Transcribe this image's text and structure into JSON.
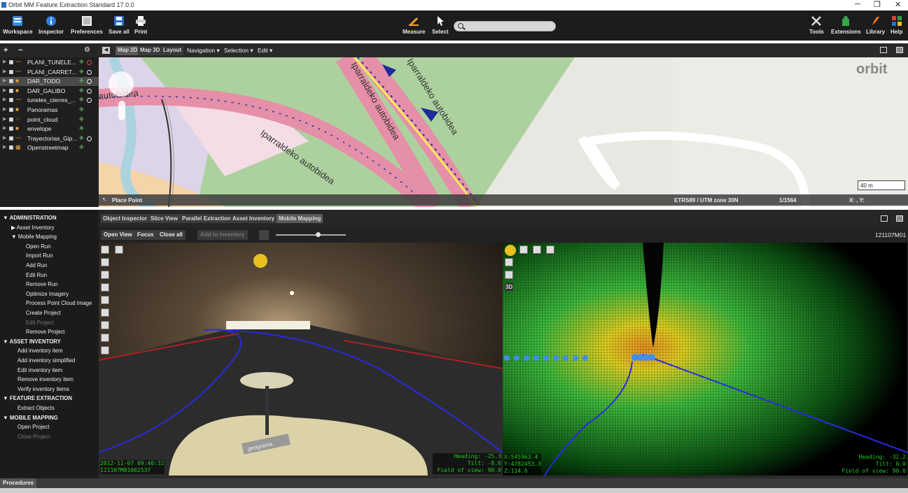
{
  "window": {
    "title": "Orbit MM Feature Extraction Standard 17.0.0",
    "minimize": "─",
    "restore": "❐",
    "close": "✕"
  },
  "ribbon": {
    "left": [
      {
        "label": "Workspace",
        "icon": "workspace-icon"
      },
      {
        "label": "Inspector",
        "icon": "info-icon"
      },
      {
        "label": "Preferences",
        "icon": "preferences-icon"
      },
      {
        "label": "Save all",
        "icon": "save-icon"
      },
      {
        "label": "Print",
        "icon": "print-icon"
      }
    ],
    "center": [
      {
        "label": "Measure",
        "icon": "measure-icon"
      },
      {
        "label": "Select",
        "icon": "cursor-icon"
      }
    ],
    "search_placeholder": "",
    "right": [
      {
        "label": "Tools",
        "icon": "tools-icon"
      },
      {
        "label": "Extensions",
        "icon": "extensions-icon"
      },
      {
        "label": "Library",
        "icon": "library-icon"
      },
      {
        "label": "Help",
        "icon": "help-icon"
      }
    ]
  },
  "layer_toolbar": {
    "add": "+",
    "remove": "−",
    "settings": "⚙"
  },
  "layers": [
    {
      "name": "PLANI_TUNELE...",
      "selected": false,
      "icon": "line-icon",
      "r2": "red"
    },
    {
      "name": "PLANI_CARRET...",
      "selected": false,
      "icon": "line-icon",
      "r2": "white"
    },
    {
      "name": "DAR_TODO",
      "selected": true,
      "icon": "point-icon",
      "r2": "white"
    },
    {
      "name": "DAR_GALIBO",
      "selected": false,
      "icon": "point-icon",
      "r2": "white"
    },
    {
      "name": "tuneles_cierres_...",
      "selected": false,
      "icon": "line-icon",
      "r2": "white"
    },
    {
      "name": "Panoramas",
      "selected": false,
      "icon": "point-icon",
      "r2": ""
    },
    {
      "name": "point_cloud",
      "selected": false,
      "icon": "cloud-icon",
      "r2": ""
    },
    {
      "name": "envelope",
      "selected": false,
      "icon": "polygon-icon",
      "r2": ""
    },
    {
      "name": "Trayectorias_Gip...",
      "selected": false,
      "icon": "line-icon",
      "r2": "white"
    },
    {
      "name": "Openstreetmap",
      "selected": false,
      "icon": "map-icon",
      "r2": ""
    }
  ],
  "map_toolbar": {
    "tabs": [
      "Map 2D",
      "Map 3D",
      "Layout"
    ],
    "active_tab": "Map 2D",
    "menus": [
      "Navigation ▾",
      "Selection ▾",
      "Edit ▾"
    ]
  },
  "map": {
    "road_labels": [
      "autobidea",
      "Iparraldeko autobidea",
      "Iparraldeko autobidea",
      "Iparraldeko autobidea"
    ],
    "logo": "orbit",
    "scale_label": "40 m",
    "status_left": "Place Point",
    "crs": "ETRS89 / UTM zone 30N",
    "scale_ratio": "1/1564",
    "coords": "X: , Y: "
  },
  "procedures": {
    "items": [
      {
        "text": "ADMINISTRATION",
        "level": 0,
        "header": true
      },
      {
        "text": "Asset Inventory",
        "level": 1,
        "header": false,
        "arrow": "▶"
      },
      {
        "text": "Mobile Mapping",
        "level": 1,
        "header": false,
        "arrow": "▼"
      },
      {
        "text": "Open Run",
        "level": 2
      },
      {
        "text": "Import Run",
        "level": 2
      },
      {
        "text": "Add Run",
        "level": 2
      },
      {
        "text": "Edit Run",
        "level": 2
      },
      {
        "text": "Remove Run",
        "level": 2
      },
      {
        "text": "Optimize Imagery",
        "level": 2
      },
      {
        "text": "Process Point Cloud Image",
        "level": 2
      },
      {
        "text": "Create Project",
        "level": 2
      },
      {
        "text": "Edit Project",
        "level": 2,
        "disabled": true
      },
      {
        "text": "Remove Project",
        "level": 2
      },
      {
        "text": "ASSET INVENTORY",
        "level": 0,
        "header": true
      },
      {
        "text": "Add inventory item",
        "level": 1
      },
      {
        "text": "Add inventory simplified",
        "level": 1
      },
      {
        "text": "Edit inventory item",
        "level": 1
      },
      {
        "text": "Remove inventory item",
        "level": 1
      },
      {
        "text": "Verify inventory items",
        "level": 1
      },
      {
        "text": "FEATURE EXTRACTION",
        "level": 0,
        "header": true
      },
      {
        "text": "Extract Objects",
        "level": 1
      },
      {
        "text": "MOBILE MAPPING",
        "level": 0,
        "header": true
      },
      {
        "text": "Open Project",
        "level": 1
      },
      {
        "text": "Close Project",
        "level": 1,
        "disabled": true
      }
    ],
    "footer": "Procedures"
  },
  "bottom_tabs": {
    "tabs": [
      "Object Inspector",
      "Slice View",
      "Parallel Extraction",
      "Asset Inventory",
      "Mobile Mapping"
    ],
    "active": "Mobile Mapping"
  },
  "view_toolbar": {
    "buttons": [
      "Open View",
      "Focus",
      "Close all"
    ],
    "disabled_button": "Add to inventory",
    "slider_value": 0.6,
    "run_id": "121107M01"
  },
  "photo_view": {
    "timestamp": "2012-11-07 09:40:32",
    "frame_id": "121107M01002537",
    "heading_label": "Heading:",
    "heading": "-25.3",
    "tilt_label": "Tilt:",
    "tilt": "-8.6",
    "fov_label": "Field of view:",
    "fov": "90.0",
    "watermark": "geograma"
  },
  "cloud_view": {
    "x_label": "X:",
    "x": "545963.4",
    "y_label": "Y:",
    "y": "4782453.3",
    "z_label": "Z:",
    "z": "114.6",
    "heading_label": "Heading:",
    "heading": "-32.2",
    "tilt_label": "Tilt:",
    "tilt": "0.0",
    "fov_label": "Field of view:",
    "fov": "90.0",
    "mode_label": "3D"
  },
  "colors": {
    "ribbon_bg": "#1c1c1c",
    "overlay_text": "#22c922",
    "motorway": "#e58fa8",
    "park": "#add19e",
    "trajectory": "#1f2aa8"
  }
}
